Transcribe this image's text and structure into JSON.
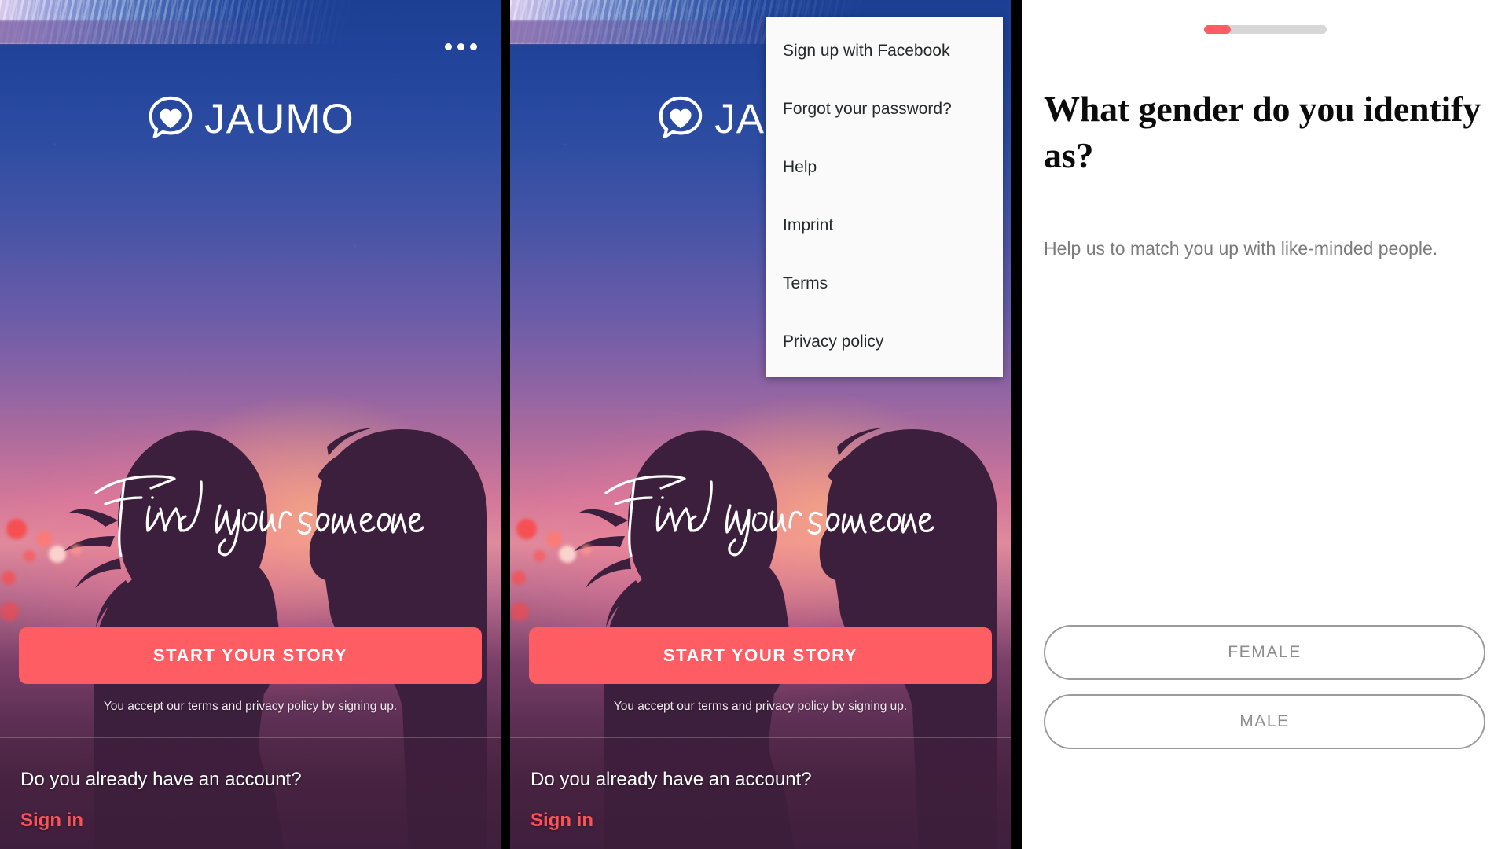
{
  "brand": {
    "name": "JAUMO",
    "logo_icon": "speech-bubble-heart-icon"
  },
  "colors": {
    "accent": "#fd5d63",
    "signin_link": "#fa5458",
    "cta_background": "#fd5d63",
    "progress_fill": "#fd5d63",
    "progress_track": "#d7d7d7",
    "gender_button_border": "#9b9b9b",
    "gender_button_text": "#8d8d8d",
    "menu_background": "#fafafa",
    "menu_text": "#26292b"
  },
  "screen_welcome": {
    "overflow_icon": "more-horizontal-icon",
    "tagline": "Find your someone",
    "cta_label": "START YOUR STORY",
    "terms_note": "You accept our terms and privacy policy by signing up.",
    "have_account_text": "Do you already have an account?",
    "signin_label": "Sign in"
  },
  "screen_menu": {
    "items": [
      {
        "label": "Sign up with Facebook"
      },
      {
        "label": "Forgot your password?"
      },
      {
        "label": "Help"
      },
      {
        "label": "Imprint"
      },
      {
        "label": "Terms"
      },
      {
        "label": "Privacy policy"
      }
    ]
  },
  "screen_gender": {
    "progress_percent": "22",
    "title": "What gender do you identify as?",
    "subtitle": "Help us to match you up with like-minded people.",
    "options": [
      {
        "label": "FEMALE"
      },
      {
        "label": "MALE"
      }
    ]
  }
}
